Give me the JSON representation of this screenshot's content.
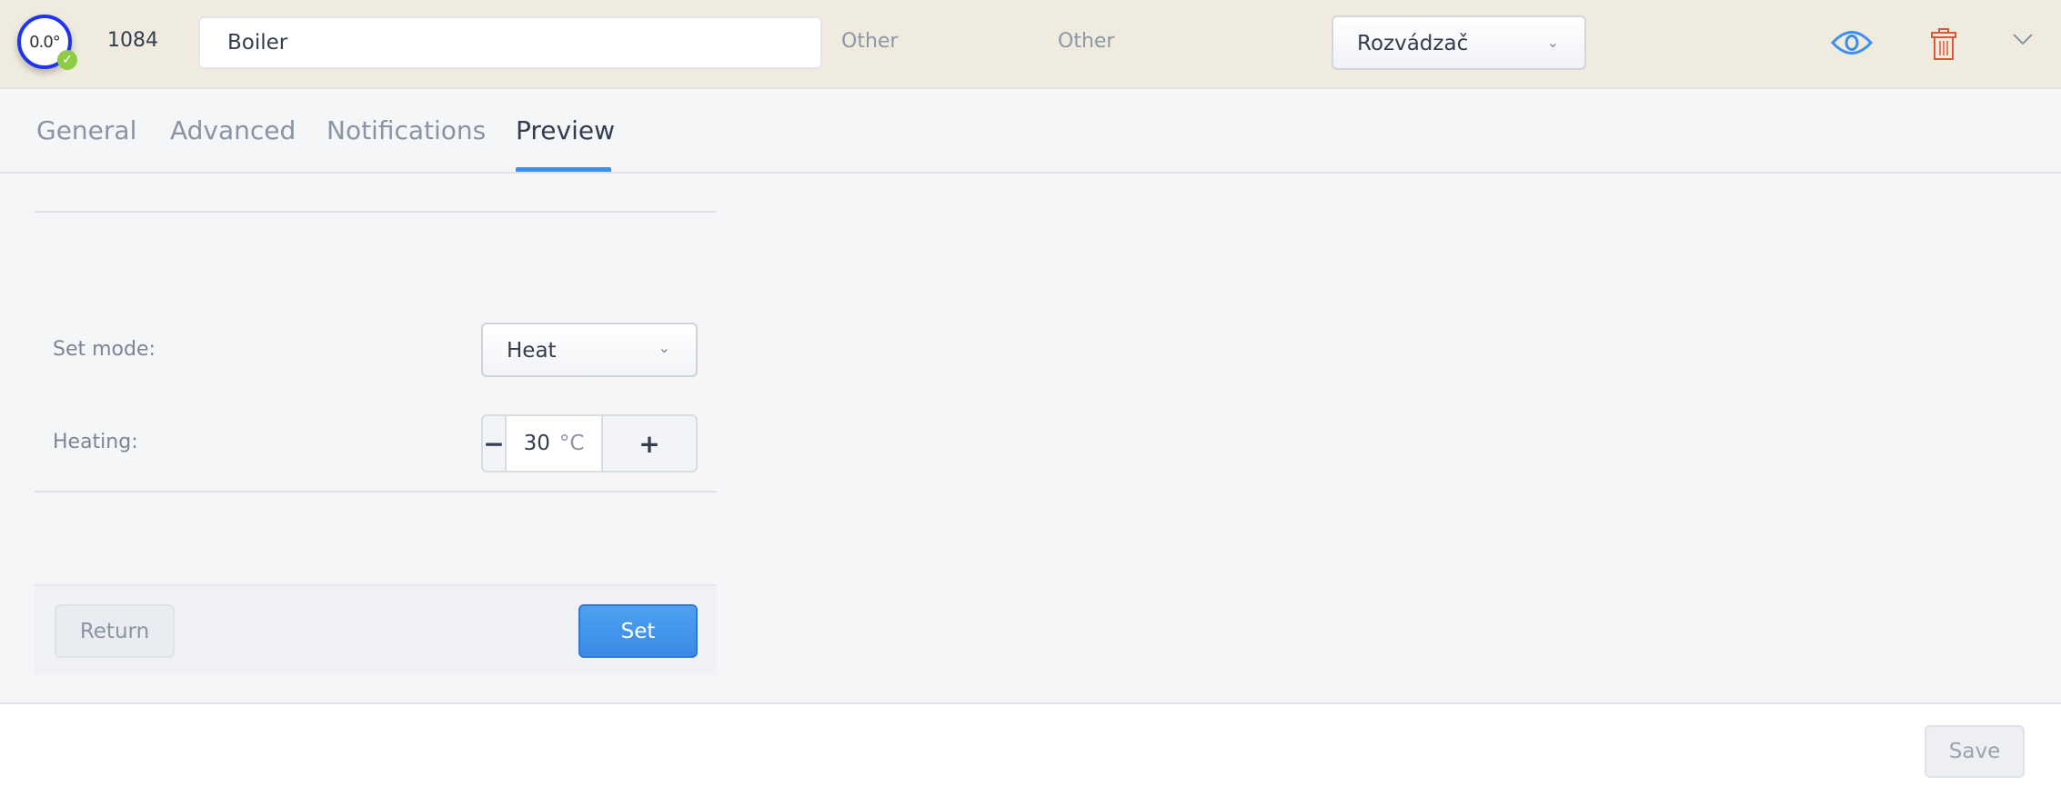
{
  "header": {
    "temperature": "0.0°",
    "device_id": "1084",
    "name_value": "Boiler",
    "type_1": "Other",
    "type_2": "Other",
    "room_select": "Rozvádzač",
    "status_color": "#8fcc45",
    "accent_color": "#3b8ff0",
    "delete_color": "#d9573c"
  },
  "tabs": [
    {
      "label": "General"
    },
    {
      "label": "Advanced"
    },
    {
      "label": "Notifications"
    },
    {
      "label": "Preview",
      "active": true
    }
  ],
  "preview": {
    "mode_label": "Set mode:",
    "mode_value": "Heat",
    "heating_label": "Heating:",
    "heating_value": "30",
    "heating_unit": "°C",
    "minus": "−",
    "plus": "+",
    "return_label": "Return",
    "set_label": "Set"
  },
  "footer": {
    "save_label": "Save"
  }
}
